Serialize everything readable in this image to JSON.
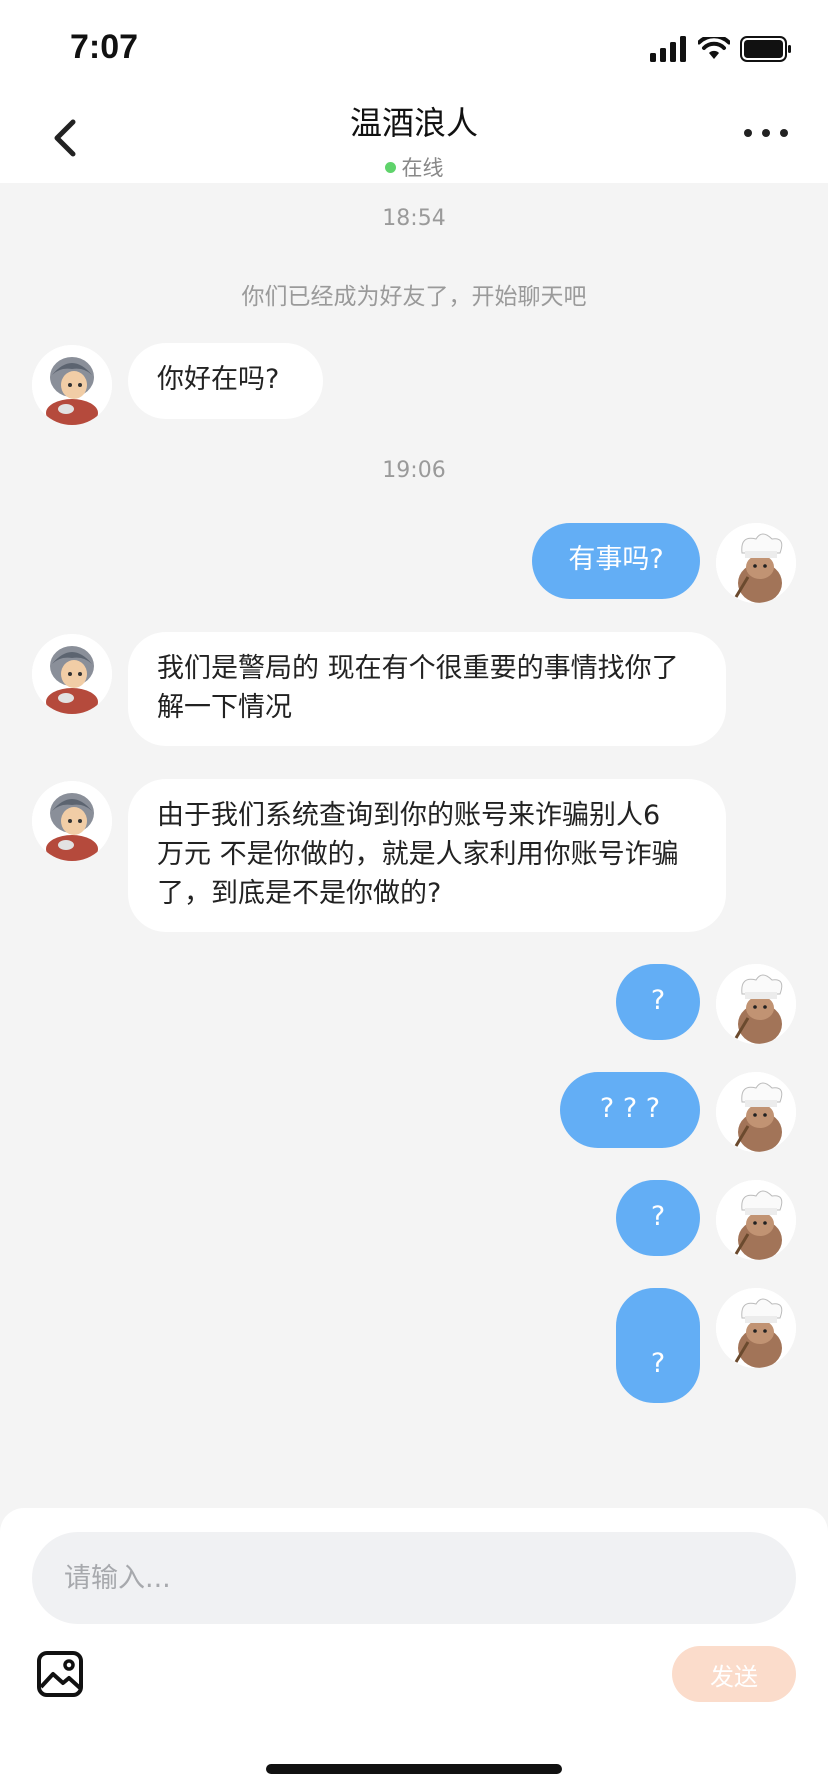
{
  "status_bar": {
    "time": "7:07"
  },
  "header": {
    "title": "温酒浪人",
    "status": "在线"
  },
  "messages": {
    "ts1": "18:54",
    "system": "你们已经成为好友了，开始聊天吧",
    "m1": "你好在吗?",
    "ts2": "19:06",
    "m2": "有事吗?",
    "m3_l1": "我们是警局的 现在有个很重要的事情找你了",
    "m3_l2": "解一下情况",
    "m4_l1": "由于我们系统查询到你的账号来诈骗别人6",
    "m4_l2": "万元 不是你做的，就是人家利用你账号诈骗",
    "m4_l3": "了，到底是不是你做的?",
    "m5": "?",
    "m6": "? ? ?",
    "m7": "?",
    "m8": "?"
  },
  "composer": {
    "placeholder": "请输入...",
    "send_label": "发送"
  },
  "colors": {
    "outgoing_bubble": "#63aef5",
    "send_button": "#fbdccb",
    "online_dot": "#5fd36b"
  },
  "icons": [
    "back-icon",
    "more-icon",
    "image-icon",
    "signal-icon",
    "wifi-icon",
    "battery-icon"
  ]
}
